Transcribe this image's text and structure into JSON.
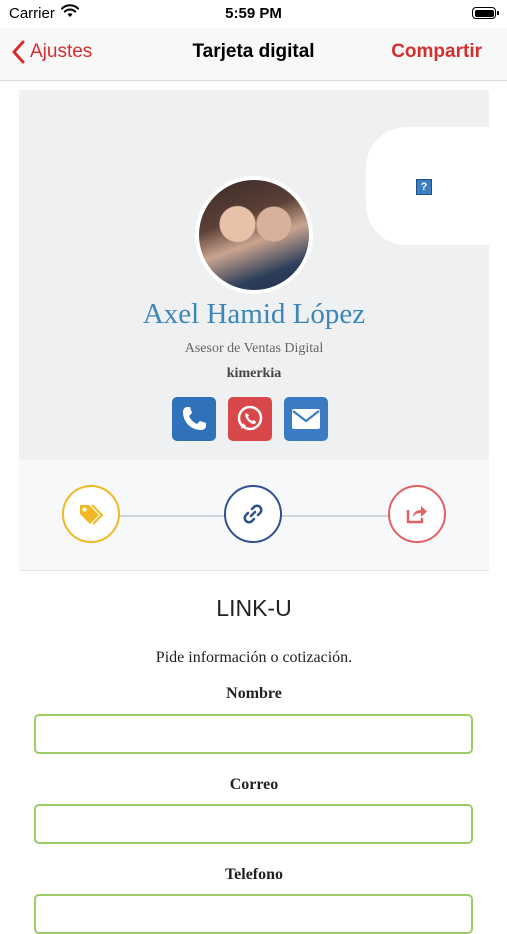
{
  "status_bar": {
    "carrier": "Carrier",
    "time": "5:59 PM",
    "battery_level": 1.0
  },
  "nav": {
    "back_label": "Ajustes",
    "title": "Tarjeta digital",
    "share_label": "Compartir"
  },
  "profile": {
    "name": "Axel Hamid López",
    "role": "Asesor de Ventas Digital",
    "company": "kimerkia",
    "broken_image_glyph": "?"
  },
  "contact_buttons": [
    {
      "icon": "phone-icon",
      "color": "#2f72b9"
    },
    {
      "icon": "whatsapp-icon",
      "color": "#d8474a"
    },
    {
      "icon": "envelope-icon",
      "color": "#3b7bc3"
    }
  ],
  "actions": [
    {
      "icon": "tag-icon",
      "color": "#f0b824"
    },
    {
      "icon": "link-icon",
      "color": "#2f4f8f"
    },
    {
      "icon": "share-icon",
      "color": "#e06161"
    }
  ],
  "form": {
    "title": "LINK-U",
    "subtitle": "Pide información o cotización.",
    "fields": [
      {
        "label": "Nombre",
        "value": ""
      },
      {
        "label": "Correo",
        "value": ""
      },
      {
        "label": "Telefono",
        "value": ""
      }
    ]
  },
  "colors": {
    "accent_red": "#d32f2f",
    "name_blue": "#3d86b8",
    "input_border_green": "#9ccc65"
  }
}
